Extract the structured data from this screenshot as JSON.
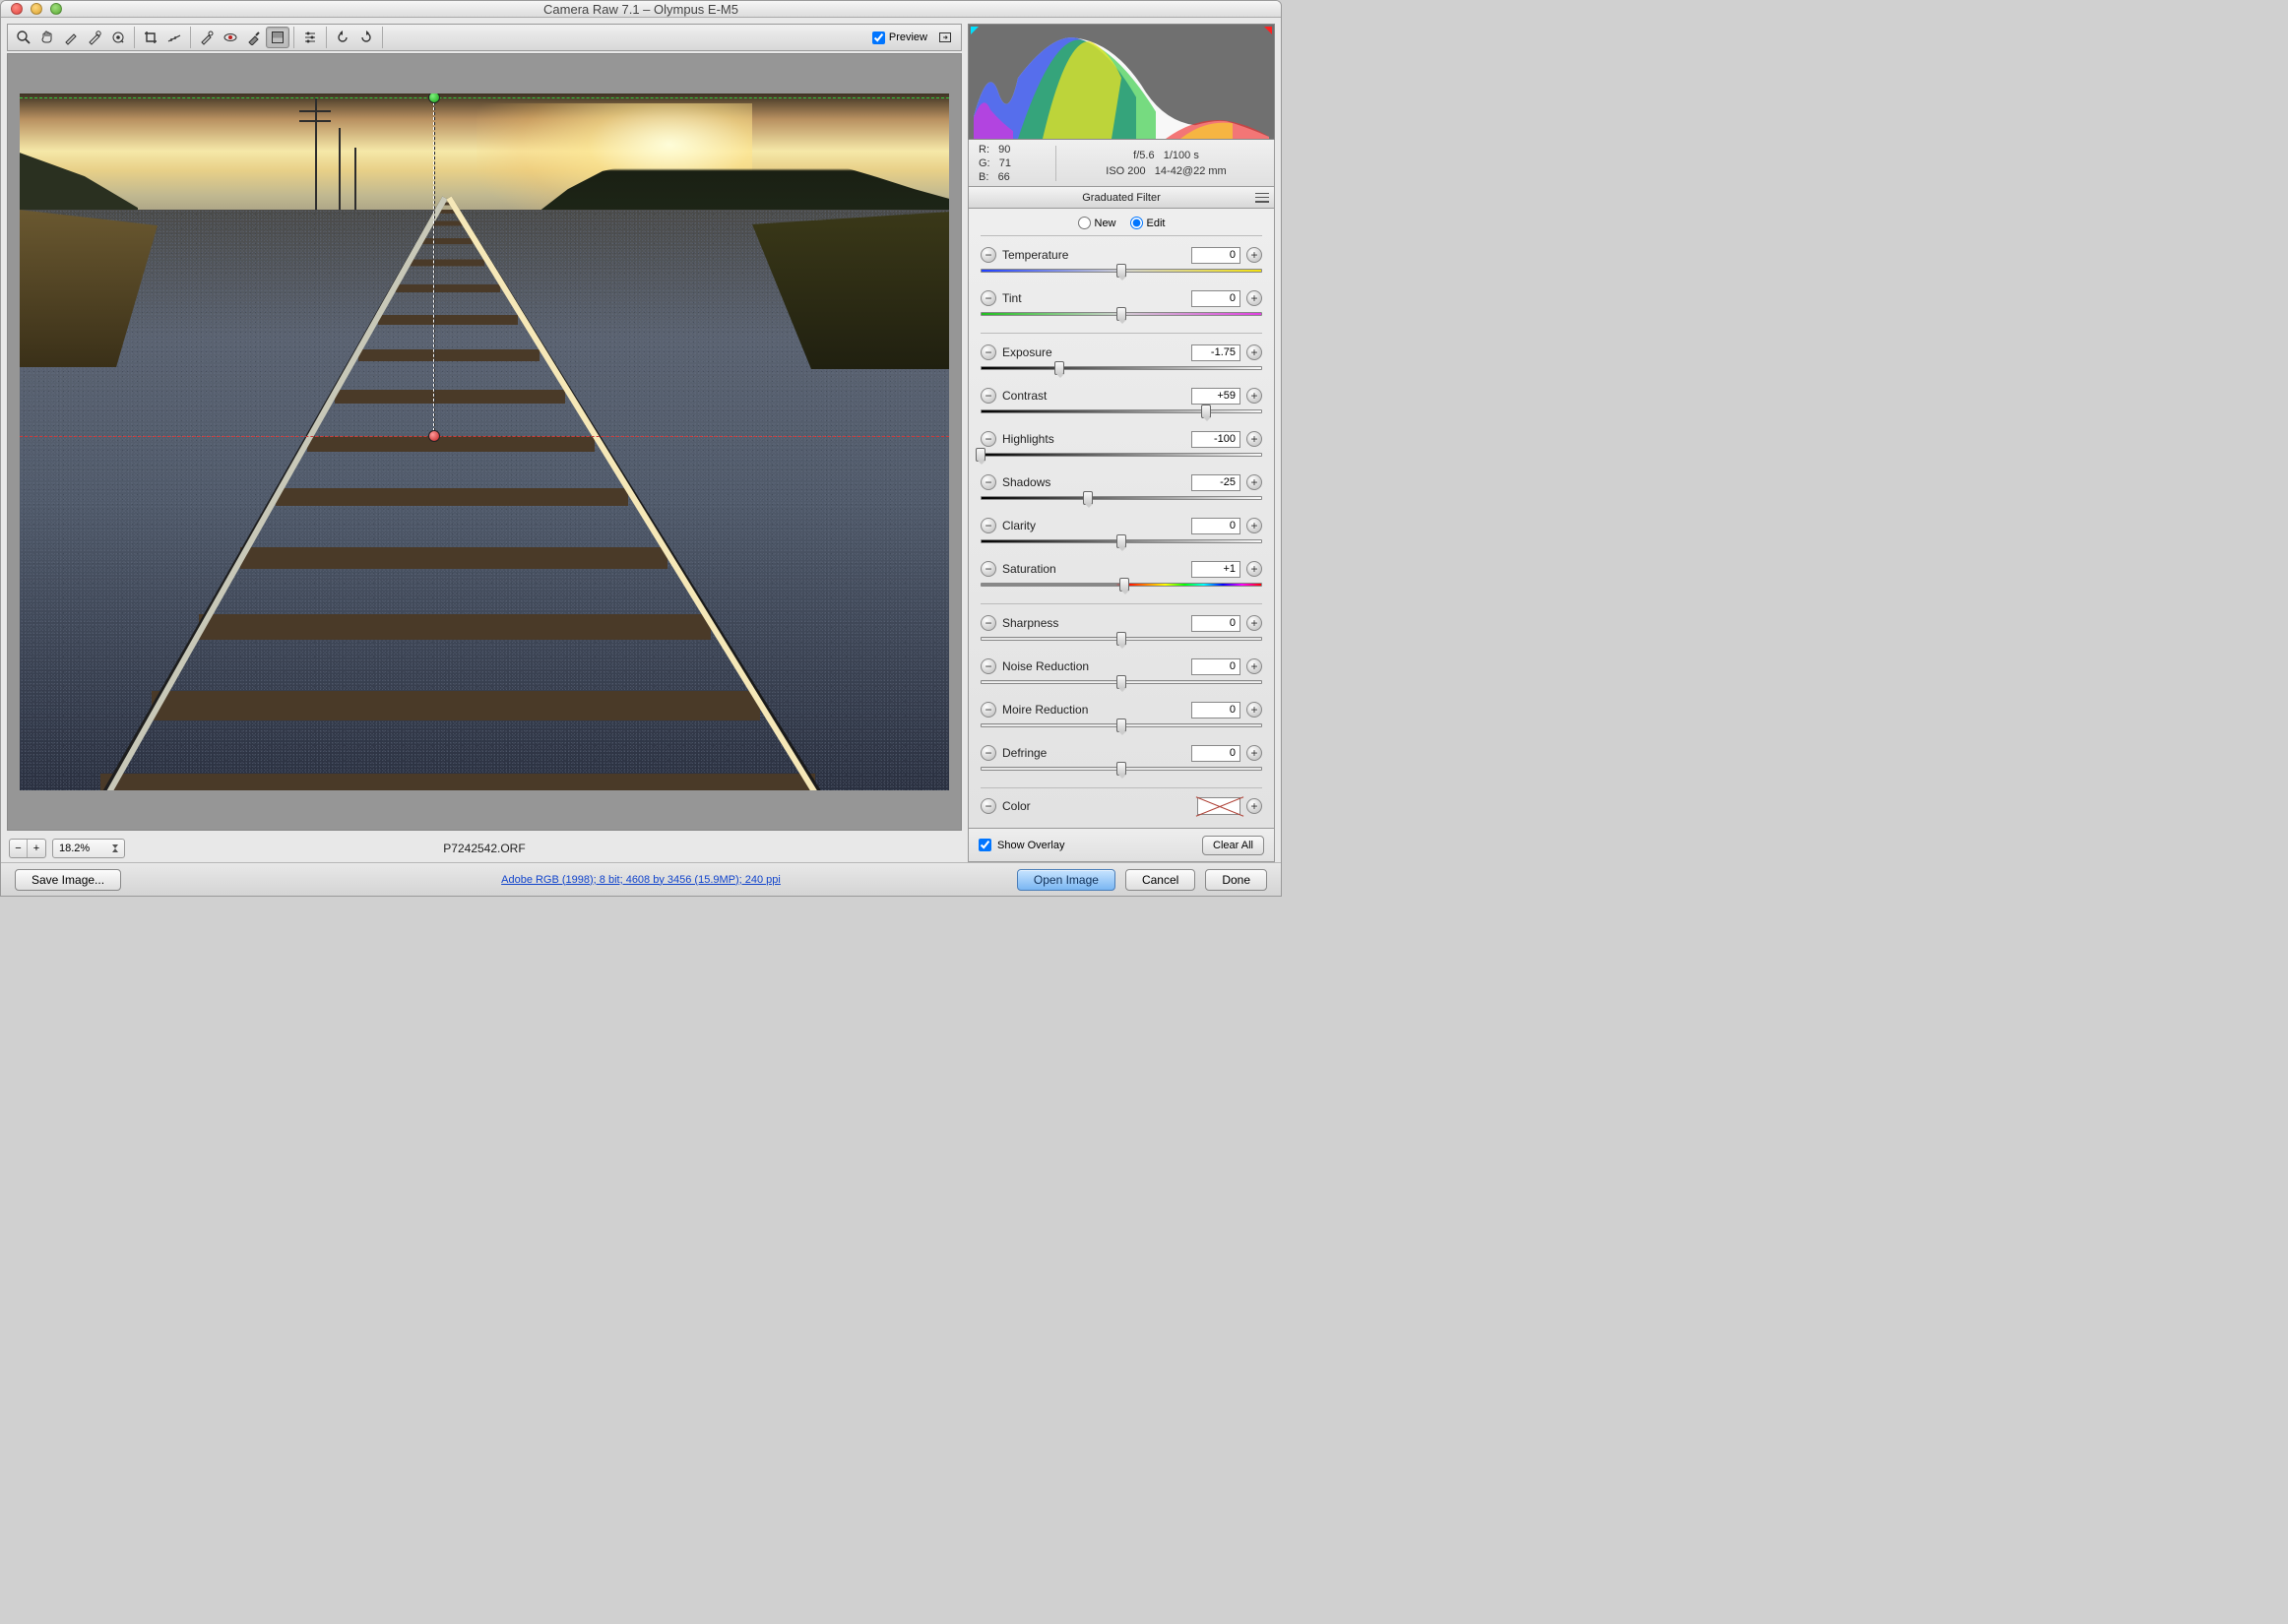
{
  "window": {
    "title": "Camera Raw 7.1  –  Olympus E-M5"
  },
  "toolbar": {
    "preview_label": "Preview",
    "preview_checked": true,
    "tools": [
      "zoom",
      "hand",
      "white-balance",
      "color-sampler",
      "target-adjust",
      "crop",
      "straighten",
      "spot",
      "redeye",
      "adjustment-brush",
      "graduated-filter",
      "prefs",
      "rotate-ccw",
      "rotate-cw"
    ]
  },
  "canvas": {
    "zoom": "18.2%",
    "filename": "P7242542.ORF"
  },
  "histogram": {
    "rgb": {
      "R": "90",
      "G": "71",
      "B": "66"
    },
    "aperture": "f/5.6",
    "shutter": "1/100 s",
    "iso": "ISO 200",
    "lens": "14-42@22 mm"
  },
  "panel": {
    "title": "Graduated Filter",
    "mode_new": "New",
    "mode_edit": "Edit",
    "mode_selected": "edit",
    "overlay_label": "Show Overlay",
    "overlay_checked": true,
    "clear_all": "Clear All",
    "color_label": "Color",
    "sliders": {
      "temperature": {
        "label": "Temperature",
        "value": "0",
        "pos": 50,
        "bar": "temp"
      },
      "tint": {
        "label": "Tint",
        "value": "0",
        "pos": 50,
        "bar": "tint"
      },
      "exposure": {
        "label": "Exposure",
        "value": "-1.75",
        "pos": 28,
        "bar": "bw"
      },
      "contrast": {
        "label": "Contrast",
        "value": "+59",
        "pos": 80,
        "bar": "bw"
      },
      "highlights": {
        "label": "Highlights",
        "value": "-100",
        "pos": 0,
        "bar": "bw"
      },
      "shadows": {
        "label": "Shadows",
        "value": "-25",
        "pos": 38,
        "bar": "bw"
      },
      "clarity": {
        "label": "Clarity",
        "value": "0",
        "pos": 50,
        "bar": "bw"
      },
      "saturation": {
        "label": "Saturation",
        "value": "+1",
        "pos": 51,
        "bar": "sat"
      },
      "sharpness": {
        "label": "Sharpness",
        "value": "0",
        "pos": 50,
        "bar": "plain"
      },
      "noise": {
        "label": "Noise Reduction",
        "value": "0",
        "pos": 50,
        "bar": "plain"
      },
      "moire": {
        "label": "Moire Reduction",
        "value": "0",
        "pos": 50,
        "bar": "plain"
      },
      "defringe": {
        "label": "Defringe",
        "value": "0",
        "pos": 50,
        "bar": "plain"
      }
    }
  },
  "footer": {
    "save": "Save Image...",
    "workflow_link": "Adobe RGB (1998); 8 bit; 4608 by 3456 (15.9MP); 240 ppi",
    "open": "Open Image",
    "cancel": "Cancel",
    "done": "Done"
  }
}
